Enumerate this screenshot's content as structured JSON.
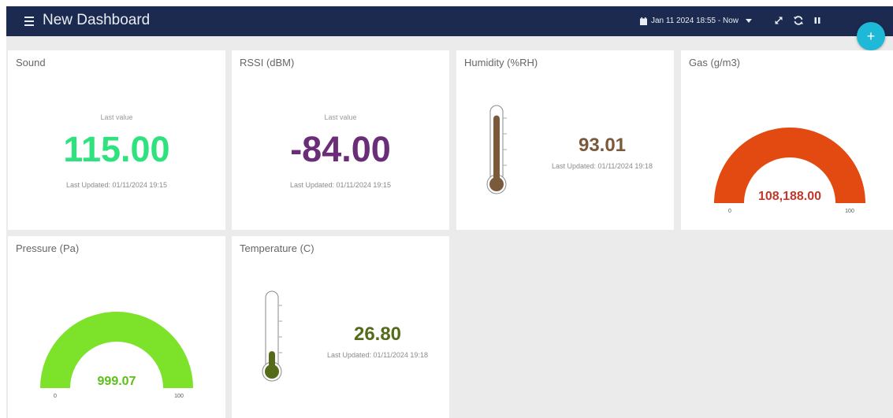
{
  "header": {
    "title": "New Dashboard",
    "date_range": "Jan 11 2024 18:55 - Now",
    "background": "#1b2a4e"
  },
  "fab": {
    "label": "+",
    "color": "#1db9d6"
  },
  "widgets": {
    "sound": {
      "title": "Sound",
      "caption": "Last value",
      "value": "115.00",
      "updated": "Last Updated: 01/11/2024 19:15",
      "color": "#2ee27d"
    },
    "rssi": {
      "title": "RSSI (dBM)",
      "caption": "Last value",
      "value": "-84.00",
      "updated": "Last Updated: 01/11/2024 19:15",
      "color": "#6a2d78"
    },
    "humidity": {
      "title": "Humidity (%RH)",
      "value": "93.01",
      "updated": "Last Updated: 01/11/2024 19:18",
      "fill_fraction": 0.93,
      "color": "#7a5a3a"
    },
    "gas": {
      "title": "Gas (g/m3)",
      "value": "108,188.00",
      "min": "0",
      "max": "100",
      "fill_fraction": 1.0,
      "color": "#e24a12",
      "value_color": "#c0392b"
    },
    "pressure": {
      "title": "Pressure (Pa)",
      "value": "999.07",
      "min": "0",
      "max": "100",
      "fill_fraction": 1.0,
      "color": "#7de22a",
      "value_color": "#5cbf1a"
    },
    "temperature": {
      "title": "Temperature (C)",
      "value": "26.80",
      "updated": "Last Updated: 01/11/2024 19:18",
      "fill_fraction": 0.27,
      "color": "#556b1a"
    }
  }
}
